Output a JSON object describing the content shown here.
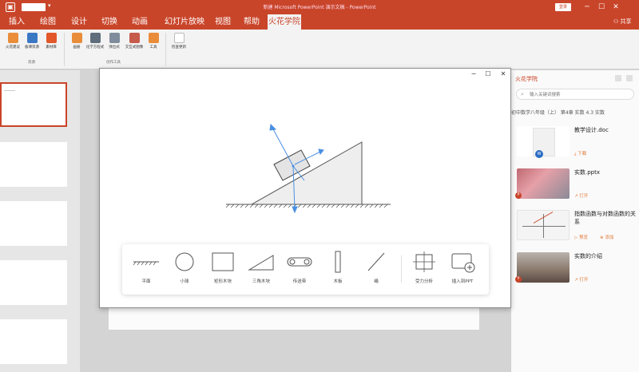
{
  "titlebar": {
    "title": "新建 Microsoft PowerPoint 演示文稿 - PowerPoint",
    "login_label": "登录",
    "minimize_icon": "minimize-icon",
    "maximize_icon": "restore-icon",
    "close_icon": "close-icon"
  },
  "tabs": [
    {
      "label": "插入"
    },
    {
      "label": "绘图"
    },
    {
      "label": "设计"
    },
    {
      "label": "切换"
    },
    {
      "label": "动画"
    },
    {
      "label": "幻灯片放映"
    },
    {
      "label": "视图"
    },
    {
      "label": "帮助"
    },
    {
      "label": "火花学院",
      "active": true
    }
  ],
  "share_label": "共享",
  "ribbon": {
    "group1": {
      "label": "资源",
      "buttons": [
        {
          "label": "火花建议",
          "color": "#e98d3a"
        },
        {
          "label": "备课资源",
          "color": "#3b78c4"
        },
        {
          "label": "素材库",
          "color": "#e2582b"
        }
      ]
    },
    "group2": {
      "label": "创作工具",
      "buttons": [
        {
          "label": "画册",
          "color": "#e98d3a"
        },
        {
          "label": "化学方程式",
          "color": "#5f6d7c"
        },
        {
          "label": "弹出式",
          "color": "#7f8c9b"
        },
        {
          "label": "交互式图像",
          "color": "#c65a4b"
        },
        {
          "label": "工具",
          "color": "#e98d3a"
        }
      ]
    },
    "group3": {
      "label": "",
      "buttons": [
        {
          "label": "检查更新",
          "color": "#444444"
        }
      ]
    }
  },
  "panel": {
    "title": "火花学院",
    "search_placeholder": "输入关键词搜索",
    "breadcrumb": "初中数学八年级（上）  第4章 实数  4.3 实数",
    "resources": [
      {
        "title": "教学设计.doc",
        "action": "下载",
        "badge": "W"
      },
      {
        "title": "实数.pptx",
        "action": "打开",
        "badge": "P"
      },
      {
        "title": "指数函数与对数函数的关系",
        "action": "预览",
        "action2": "添加"
      },
      {
        "title": "实数的介绍",
        "action": "打开",
        "badge": "P"
      }
    ]
  },
  "tool": {
    "palette": [
      {
        "label": "平面",
        "icon": "ground-plane-icon"
      },
      {
        "label": "小球",
        "icon": "ball-icon"
      },
      {
        "label": "矩形木块",
        "icon": "rectangle-block-icon"
      },
      {
        "label": "三角木块",
        "icon": "triangle-block-icon"
      },
      {
        "label": "传送带",
        "icon": "conveyor-belt-icon"
      },
      {
        "label": "木板",
        "icon": "board-icon"
      },
      {
        "label": "绳",
        "icon": "rope-icon"
      },
      {
        "label": "受力分析",
        "icon": "force-analysis-icon"
      },
      {
        "label": "插入到PPT",
        "icon": "insert-to-ppt-icon"
      }
    ]
  },
  "colors": {
    "brand": "#c9452a",
    "accent": "#e07b39",
    "force_arrow": "#4a90e2"
  }
}
